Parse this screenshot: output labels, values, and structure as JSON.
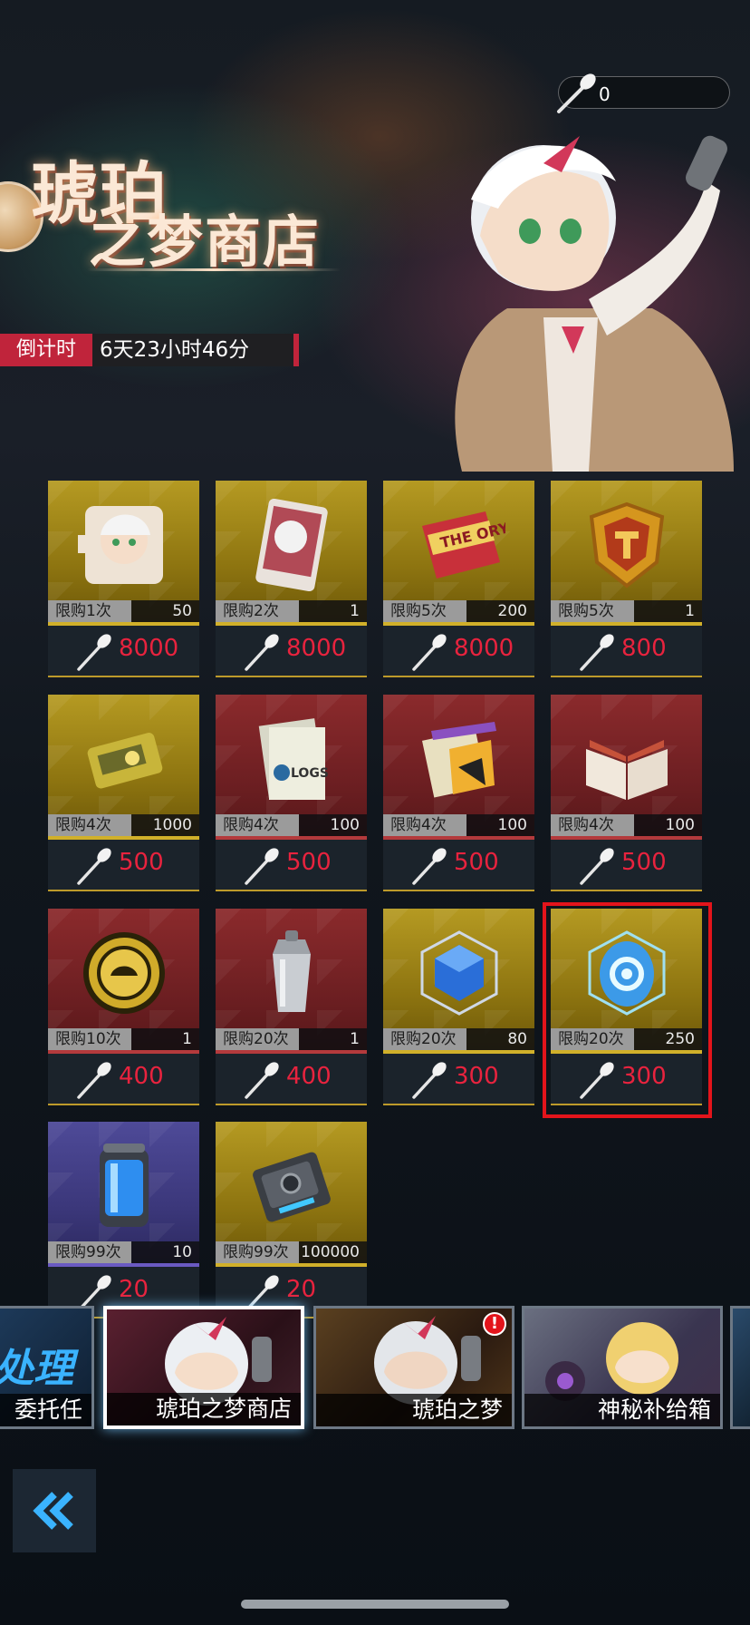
{
  "currency": {
    "value": "0"
  },
  "banner": {
    "title_line1": "琥珀",
    "title_line2": "之梦商店",
    "countdown_label": "倒计时",
    "countdown_value": "6天23小时46分"
  },
  "items": [
    {
      "limit": "限购1次",
      "qty": "50",
      "price": "8000",
      "theme": "gold",
      "icon": "puzzle-portrait-icon"
    },
    {
      "limit": "限购2次",
      "qty": "1",
      "price": "8000",
      "theme": "gold",
      "icon": "character-card-icon"
    },
    {
      "limit": "限购5次",
      "qty": "200",
      "price": "8000",
      "theme": "gold",
      "icon": "theory-book-icon"
    },
    {
      "limit": "限购5次",
      "qty": "1",
      "price": "800",
      "theme": "gold",
      "icon": "shield-badge-icon"
    },
    {
      "limit": "限购4次",
      "qty": "1000",
      "price": "500",
      "theme": "gold",
      "icon": "data-chip-icon"
    },
    {
      "limit": "限购4次",
      "qty": "100",
      "price": "500",
      "theme": "red",
      "icon": "logs-papers-icon"
    },
    {
      "limit": "限购4次",
      "qty": "100",
      "price": "500",
      "theme": "red",
      "icon": "ribbon-files-icon"
    },
    {
      "limit": "限购4次",
      "qty": "100",
      "price": "500",
      "theme": "red",
      "icon": "open-book-icon"
    },
    {
      "limit": "限购10次",
      "qty": "1",
      "price": "400",
      "theme": "red",
      "icon": "gold-coin-icon"
    },
    {
      "limit": "限购20次",
      "qty": "1",
      "price": "400",
      "theme": "red",
      "icon": "cocktail-shaker-icon"
    },
    {
      "limit": "限购20次",
      "qty": "80",
      "price": "300",
      "theme": "gold",
      "icon": "blue-cube-icon"
    },
    {
      "limit": "限购20次",
      "qty": "250",
      "price": "300",
      "theme": "gold",
      "icon": "blue-crystal-icon"
    },
    {
      "limit": "限购99次",
      "qty": "10",
      "price": "20",
      "theme": "blue",
      "icon": "energy-canister-icon"
    },
    {
      "limit": "限购99次",
      "qty": "100000",
      "price": "20",
      "theme": "gold",
      "icon": "memory-module-icon"
    }
  ],
  "tabs": [
    {
      "big": "处理",
      "label": "委托任务"
    },
    {
      "label": "琥珀之梦商店"
    },
    {
      "label": "琥珀之梦",
      "badge": "!"
    },
    {
      "label": "神秘补给箱"
    }
  ]
}
